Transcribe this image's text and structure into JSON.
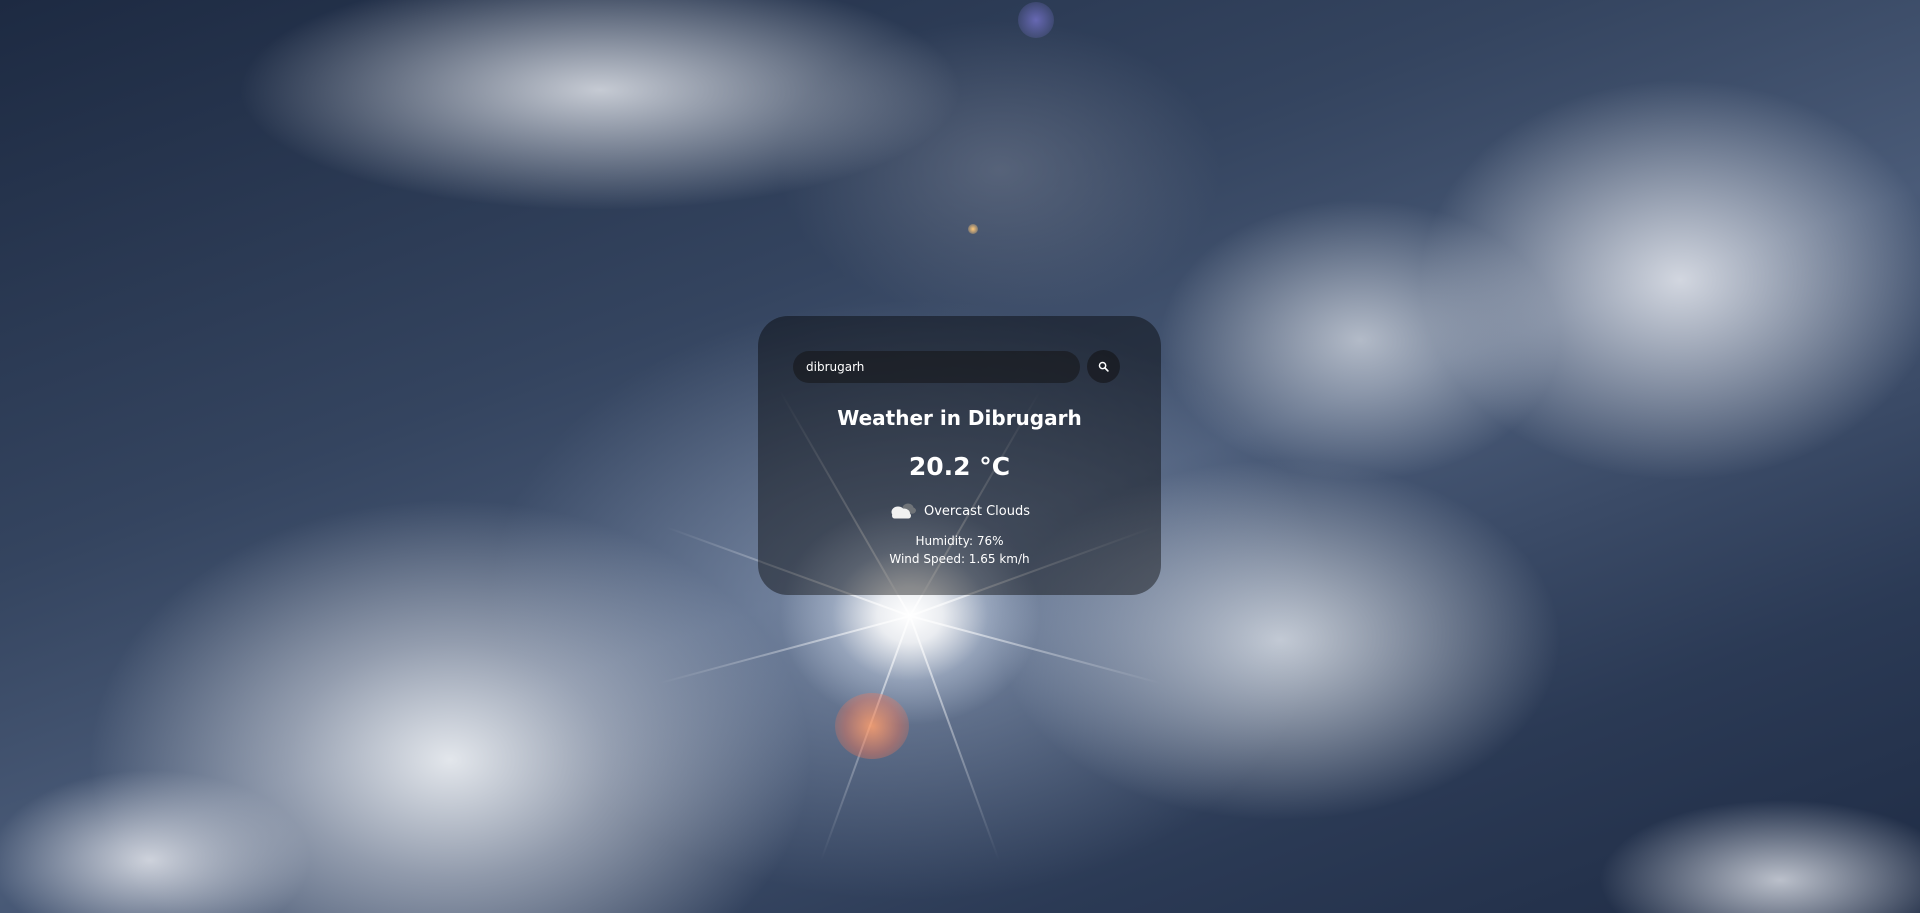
{
  "search": {
    "value": "dibrugarh",
    "icon": "search-icon"
  },
  "weather": {
    "title": "Weather in Dibrugarh",
    "temperature": "20.2 °C",
    "condition_icon": "cloud-icon",
    "description": "Overcast Clouds",
    "humidity": "Humidity: 76%",
    "wind": "Wind Speed: 1.65 km/h"
  }
}
